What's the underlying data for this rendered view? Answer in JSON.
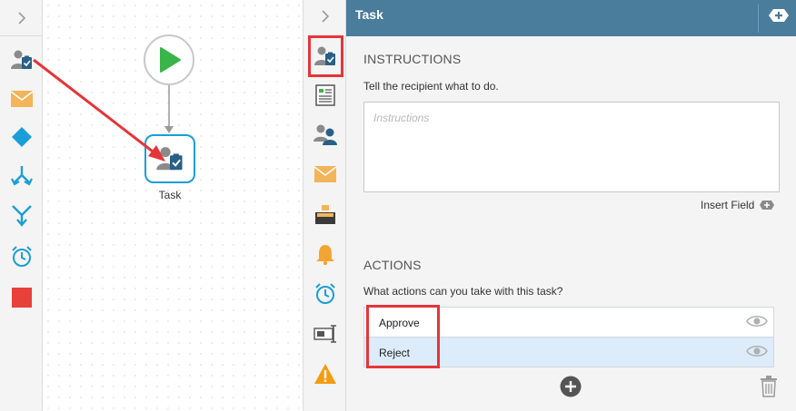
{
  "canvas": {
    "start_node": {
      "icon": "play-icon"
    },
    "task_node": {
      "label": "Task",
      "icon": "task-user-icon"
    }
  },
  "palette": {
    "items": [
      {
        "name": "task",
        "icon": "task-user-icon"
      },
      {
        "name": "email",
        "icon": "envelope-icon"
      },
      {
        "name": "decision",
        "icon": "diamond-icon"
      },
      {
        "name": "split",
        "icon": "split-icon"
      },
      {
        "name": "merge",
        "icon": "merge-icon"
      },
      {
        "name": "timer",
        "icon": "alarm-clock-icon"
      },
      {
        "name": "end",
        "icon": "stop-square-icon"
      }
    ]
  },
  "tools": {
    "items": [
      {
        "name": "task",
        "icon": "task-user-icon",
        "selected": true
      },
      {
        "name": "form",
        "icon": "form-document-icon"
      },
      {
        "name": "assignees",
        "icon": "users-icon"
      },
      {
        "name": "email",
        "icon": "envelope-icon"
      },
      {
        "name": "escalation",
        "icon": "inbox-tray-icon"
      },
      {
        "name": "reminder",
        "icon": "bell-icon"
      },
      {
        "name": "timer",
        "icon": "alarm-clock-icon"
      },
      {
        "name": "fields",
        "icon": "field-rename-icon"
      },
      {
        "name": "warning",
        "icon": "warning-icon"
      }
    ]
  },
  "panel": {
    "title": "Task",
    "instructions": {
      "title": "INSTRUCTIONS",
      "description": "Tell the recipient what to do.",
      "value": "",
      "placeholder": "Instructions",
      "insert_field": "Insert Field"
    },
    "actions": {
      "title": "ACTIONS",
      "description": "What actions can you take with this task?",
      "items": [
        {
          "label": "Approve",
          "selected": false
        },
        {
          "label": "Reject",
          "selected": true
        }
      ]
    }
  },
  "colors": {
    "header": "#4a7c9b",
    "highlight": "#e4353a",
    "accent": "#1a9ed9",
    "play": "#3ab54a",
    "stop": "#e8403a"
  }
}
